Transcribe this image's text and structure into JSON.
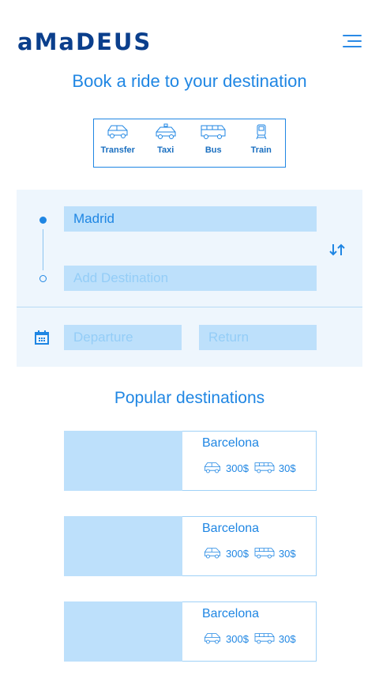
{
  "header": {
    "logo": "aMaDEUS",
    "menu_icon": "hamburger-menu-icon"
  },
  "title": "Book a ride to your destination",
  "modes": [
    {
      "label": "Transfer",
      "icon": "car-icon"
    },
    {
      "label": "Taxi",
      "icon": "taxi-icon"
    },
    {
      "label": "Bus",
      "icon": "bus-icon"
    },
    {
      "label": "Train",
      "icon": "train-icon"
    }
  ],
  "search": {
    "from_value": "Madrid",
    "to_placeholder": "Add Destination",
    "departure_placeholder": "Departure",
    "return_placeholder": "Return"
  },
  "popular": {
    "title": "Popular destinations",
    "items": [
      {
        "city": "Barcelona",
        "car_price": "300$",
        "bus_price": "30$"
      },
      {
        "city": "Barcelona",
        "car_price": "300$",
        "bus_price": "30$"
      },
      {
        "city": "Barcelona",
        "car_price": "300$",
        "bus_price": "30$"
      }
    ]
  },
  "colors": {
    "brand": "#0b3f8c",
    "accent": "#1f86e3",
    "field": "#bde0fb",
    "panel": "#eef6fd"
  }
}
